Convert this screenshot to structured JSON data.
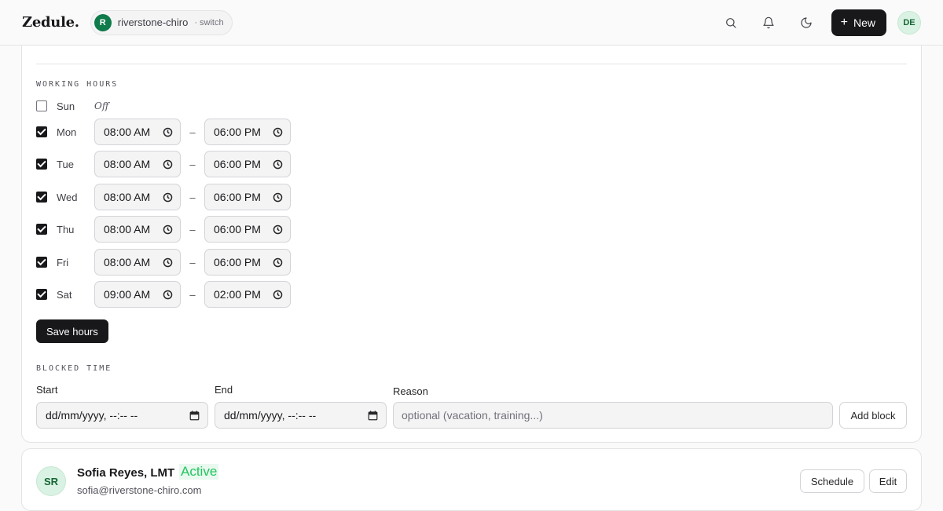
{
  "header": {
    "logo": "Zedule.",
    "workspace": {
      "initial": "R",
      "name": "riverstone-chiro",
      "switch_label": "· switch"
    },
    "new_label": "New",
    "user_initials": "DE"
  },
  "working_hours": {
    "title": "WORKING HOURS",
    "off_label": "Off",
    "days": [
      {
        "name": "Sun",
        "enabled": false,
        "start": "",
        "end": ""
      },
      {
        "name": "Mon",
        "enabled": true,
        "start": "08:00 AM",
        "end": "06:00 PM"
      },
      {
        "name": "Tue",
        "enabled": true,
        "start": "08:00 AM",
        "end": "06:00 PM"
      },
      {
        "name": "Wed",
        "enabled": true,
        "start": "08:00 AM",
        "end": "06:00 PM"
      },
      {
        "name": "Thu",
        "enabled": true,
        "start": "08:00 AM",
        "end": "06:00 PM"
      },
      {
        "name": "Fri",
        "enabled": true,
        "start": "08:00 AM",
        "end": "06:00 PM"
      },
      {
        "name": "Sat",
        "enabled": true,
        "start": "09:00 AM",
        "end": "02:00 PM"
      }
    ],
    "separator": "–",
    "save_label": "Save hours"
  },
  "blocked_time": {
    "title": "BLOCKED TIME",
    "start_label": "Start",
    "end_label": "End",
    "reason_label": "Reason",
    "start_value": "dd/mm/yyyy, --:-- --",
    "end_value": "dd/mm/yyyy, --:-- --",
    "reason_placeholder": "optional (vacation, training...)",
    "add_label": "Add block"
  },
  "staff": {
    "initials": "SR",
    "name": "Sofia Reyes, LMT",
    "status": "Active",
    "email": "sofia@riverstone-chiro.com",
    "schedule_label": "Schedule",
    "edit_label": "Edit"
  }
}
